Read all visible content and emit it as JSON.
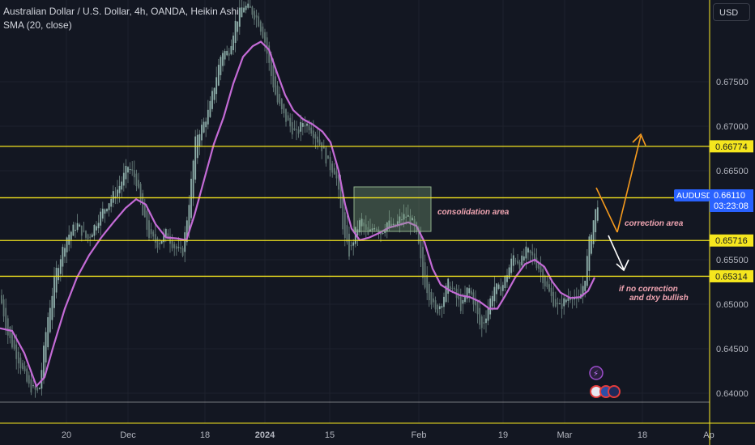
{
  "header": {
    "title": "Australian Dollar / U.S. Dollar, 4h, OANDA, Heikin Ashi",
    "indicator": "SMA (20, close)"
  },
  "currency_button": "USD",
  "colors": {
    "background": "#131722",
    "level_line": "#f5e61e",
    "sma": "#c46bd6",
    "candle": "#8aa39f",
    "ticker_badge": "#2962ff",
    "arrow_up": "#f59a1e",
    "arrow_down": "#ffffff",
    "annotation_text": "#f2a6b3"
  },
  "chart_data": {
    "type": "candlestick",
    "symbol": "AUDUSD",
    "last_price": "0.66110",
    "countdown": "03:23:08",
    "ylim": [
      0.6392,
      0.6839
    ],
    "y_ticks": [
      "0.67500",
      "0.67000",
      "0.66500",
      "0.65500",
      "0.65000",
      "0.64500",
      "0.64000"
    ],
    "x_tick_labels": [
      "20",
      "Dec",
      "18",
      "2024",
      "15",
      "Feb",
      "19",
      "Mar",
      "18",
      "Ap"
    ],
    "levels": [
      "0.66774",
      "0.66196",
      "0.65716",
      "0.65314"
    ],
    "annotations": {
      "consolidation": "consolidation area",
      "correction": "correction area",
      "no_correction": [
        "if no correction",
        "and dxy bullish"
      ]
    },
    "price_path": [
      [
        0,
        0.651
      ],
      [
        10,
        0.6465
      ],
      [
        22,
        0.644
      ],
      [
        35,
        0.6408
      ],
      [
        48,
        0.64
      ],
      [
        58,
        0.648
      ],
      [
        70,
        0.654
      ],
      [
        82,
        0.6575
      ],
      [
        95,
        0.659
      ],
      [
        108,
        0.6572
      ],
      [
        122,
        0.6598
      ],
      [
        134,
        0.6615
      ],
      [
        146,
        0.663
      ],
      [
        158,
        0.6655
      ],
      [
        168,
        0.664
      ],
      [
        176,
        0.66
      ],
      [
        185,
        0.6575
      ],
      [
        195,
        0.6568
      ],
      [
        205,
        0.658
      ],
      [
        215,
        0.6565
      ],
      [
        225,
        0.6555
      ],
      [
        234,
        0.662
      ],
      [
        242,
        0.669
      ],
      [
        250,
        0.67
      ],
      [
        258,
        0.6718
      ],
      [
        266,
        0.6752
      ],
      [
        274,
        0.6785
      ],
      [
        282,
        0.6782
      ],
      [
        290,
        0.6815
      ],
      [
        300,
        0.6836
      ],
      [
        310,
        0.683
      ],
      [
        318,
        0.682
      ],
      [
        326,
        0.68
      ],
      [
        334,
        0.676
      ],
      [
        342,
        0.6728
      ],
      [
        350,
        0.6712
      ],
      [
        358,
        0.67
      ],
      [
        366,
        0.669
      ],
      [
        374,
        0.6705
      ],
      [
        382,
        0.67
      ],
      [
        390,
        0.6688
      ],
      [
        398,
        0.6675
      ],
      [
        406,
        0.6655
      ],
      [
        414,
        0.665
      ],
      [
        420,
        0.661
      ],
      [
        426,
        0.657
      ],
      [
        432,
        0.6555
      ],
      [
        438,
        0.658
      ],
      [
        446,
        0.6595
      ],
      [
        454,
        0.6575
      ],
      [
        462,
        0.659
      ],
      [
        470,
        0.658
      ],
      [
        478,
        0.6592
      ],
      [
        486,
        0.6585
      ],
      [
        494,
        0.6596
      ],
      [
        502,
        0.66
      ],
      [
        510,
        0.659
      ],
      [
        516,
        0.657
      ],
      [
        522,
        0.653
      ],
      [
        530,
        0.651
      ],
      [
        538,
        0.649
      ],
      [
        546,
        0.6505
      ],
      [
        554,
        0.6525
      ],
      [
        562,
        0.651
      ],
      [
        570,
        0.6495
      ],
      [
        578,
        0.652
      ],
      [
        586,
        0.65
      ],
      [
        594,
        0.647
      ],
      [
        602,
        0.6495
      ],
      [
        610,
        0.652
      ],
      [
        618,
        0.6515
      ],
      [
        626,
        0.6535
      ],
      [
        634,
        0.6555
      ],
      [
        642,
        0.6545
      ],
      [
        650,
        0.656
      ],
      [
        658,
        0.6552
      ],
      [
        666,
        0.654
      ],
      [
        674,
        0.652
      ],
      [
        682,
        0.6505
      ],
      [
        690,
        0.6495
      ],
      [
        698,
        0.6505
      ],
      [
        706,
        0.6512
      ],
      [
        714,
        0.65
      ],
      [
        722,
        0.653
      ],
      [
        728,
        0.6575
      ],
      [
        734,
        0.66
      ],
      [
        738,
        0.6615
      ]
    ],
    "sma_path": [
      [
        0,
        0.6473
      ],
      [
        15,
        0.647
      ],
      [
        30,
        0.6445
      ],
      [
        45,
        0.6408
      ],
      [
        55,
        0.6418
      ],
      [
        65,
        0.645
      ],
      [
        80,
        0.6495
      ],
      [
        95,
        0.653
      ],
      [
        110,
        0.6555
      ],
      [
        125,
        0.6575
      ],
      [
        140,
        0.6592
      ],
      [
        155,
        0.6608
      ],
      [
        168,
        0.6618
      ],
      [
        180,
        0.6612
      ],
      [
        192,
        0.659
      ],
      [
        205,
        0.6575
      ],
      [
        218,
        0.6574
      ],
      [
        230,
        0.6572
      ],
      [
        240,
        0.66
      ],
      [
        252,
        0.664
      ],
      [
        264,
        0.668
      ],
      [
        276,
        0.671
      ],
      [
        288,
        0.6748
      ],
      [
        300,
        0.6778
      ],
      [
        312,
        0.679
      ],
      [
        322,
        0.6795
      ],
      [
        332,
        0.6786
      ],
      [
        342,
        0.676
      ],
      [
        352,
        0.6735
      ],
      [
        362,
        0.6718
      ],
      [
        374,
        0.6708
      ],
      [
        386,
        0.6702
      ],
      [
        398,
        0.6694
      ],
      [
        408,
        0.6682
      ],
      [
        418,
        0.665
      ],
      [
        426,
        0.6612
      ],
      [
        434,
        0.6585
      ],
      [
        444,
        0.6572
      ],
      [
        456,
        0.6575
      ],
      [
        468,
        0.658
      ],
      [
        480,
        0.6586
      ],
      [
        492,
        0.6589
      ],
      [
        504,
        0.6592
      ],
      [
        514,
        0.6588
      ],
      [
        524,
        0.657
      ],
      [
        534,
        0.654
      ],
      [
        544,
        0.6522
      ],
      [
        556,
        0.6515
      ],
      [
        568,
        0.651
      ],
      [
        580,
        0.6508
      ],
      [
        592,
        0.6503
      ],
      [
        604,
        0.6495
      ],
      [
        614,
        0.6495
      ],
      [
        624,
        0.651
      ],
      [
        636,
        0.653
      ],
      [
        648,
        0.6545
      ],
      [
        660,
        0.655
      ],
      [
        672,
        0.6542
      ],
      [
        682,
        0.6525
      ],
      [
        692,
        0.6513
      ],
      [
        704,
        0.6507
      ],
      [
        716,
        0.6508
      ],
      [
        726,
        0.6515
      ],
      [
        734,
        0.653
      ]
    ]
  }
}
